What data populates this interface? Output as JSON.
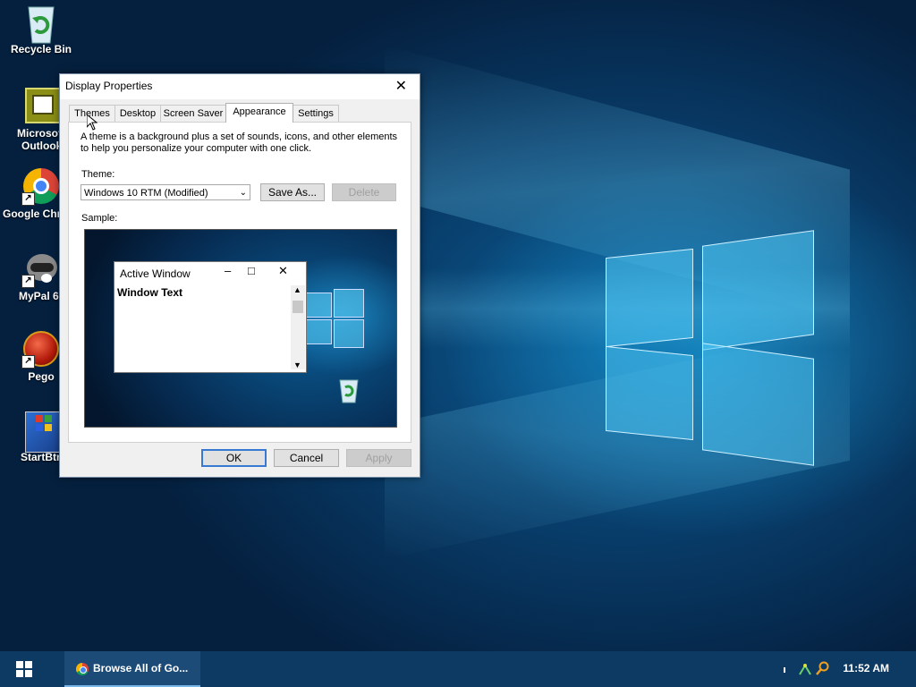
{
  "desktop": {
    "icons": [
      {
        "label": "Recycle Bin",
        "icon": "recycle-bin-icon"
      },
      {
        "label": "Microsoft Outlook",
        "line1": "Microsof",
        "line2": "Outlook",
        "icon": "outlook-icon"
      },
      {
        "label": "Google Chrome",
        "line1": "Google Chr",
        "icon": "chrome-icon"
      },
      {
        "label": "MyPal 6",
        "line1": "MyPal 6",
        "icon": "raccoon-icon"
      },
      {
        "label": "Pego",
        "line1": "Pego",
        "icon": "pego-icon"
      },
      {
        "label": "StartBtn",
        "line1": "StartBtn",
        "icon": "startbtn-icon"
      }
    ]
  },
  "dialog": {
    "title": "Display Properties",
    "tabs": [
      "Themes",
      "Desktop",
      "Screen Saver",
      "Appearance",
      "Settings"
    ],
    "active_tab": "Appearance",
    "description_line1": "A theme is a background plus a set of sounds, icons, and other elements",
    "description_line2": "to help you personalize your computer with one click.",
    "theme_label": "Theme:",
    "theme_value": "Windows 10 RTM (Modified)",
    "save_as_label": "Save As...",
    "delete_label": "Delete",
    "sample_label": "Sample:",
    "sample": {
      "window_title": "Active Window",
      "window_text": "Window Text"
    },
    "ok_label": "OK",
    "cancel_label": "Cancel",
    "apply_label": "Apply"
  },
  "taskbar": {
    "task_label": "Browse All of Go...",
    "clock": "11:52 AM"
  }
}
